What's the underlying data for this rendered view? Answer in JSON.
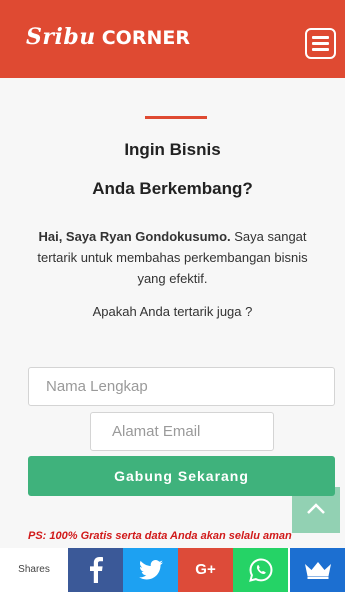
{
  "header": {
    "logo_brand": "Sribu",
    "logo_suffix": "CORNER"
  },
  "hero": {
    "title_line1": "Ingin Bisnis",
    "title_line2": "Anda Berkembang?",
    "intro_bold": "Hai, Saya Ryan Gondokusumo.",
    "intro_rest": " Saya sangat tertarik untuk membahas perkembangan bisnis yang efektif.",
    "question": "Apakah Anda tertarik juga ?"
  },
  "form": {
    "name_placeholder": "Nama Lengkap",
    "email_placeholder": "Alamat Email",
    "submit_label": "Gabung Sekarang",
    "ps_note": "PS: 100% Gratis serta data Anda akan selalu aman"
  },
  "share_bar": {
    "label": "Shares",
    "googleplus_label": "G+",
    "buttons": [
      "facebook-icon",
      "twitter-icon",
      "google-plus-icon",
      "whatsapp-icon",
      "crown-icon"
    ]
  },
  "colors": {
    "header_bg": "#df4a32",
    "accent_green": "#3fb27c",
    "ps_red": "#d11a1a",
    "facebook": "#3b5998",
    "twitter": "#1da1f2",
    "googleplus": "#dd4b39",
    "whatsapp": "#25d366",
    "crown": "#1c6fd1"
  }
}
